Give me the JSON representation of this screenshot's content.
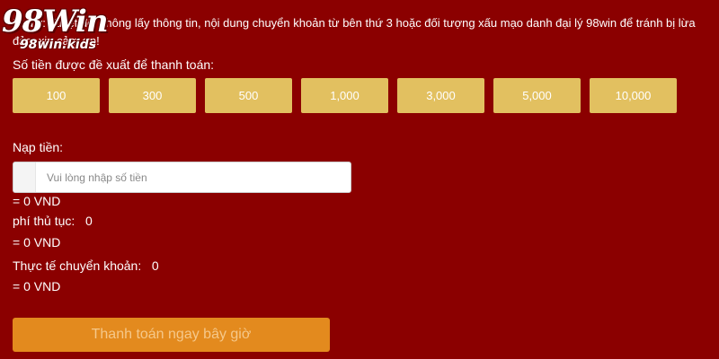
{
  "notice": "Lưu ý: Tuyệt đối không lấy thông tin, nội dung chuyển khoản từ bên thứ 3 hoặc đối tượng xấu mạo danh đại lý 98win để tránh bị lừa đảo, xin cảm ơn!",
  "logo": {
    "main": "98Win",
    "sub": "98win.kids"
  },
  "suggest_label": "Số tiền được đề xuất để thanh toán:",
  "amounts": [
    "100",
    "300",
    "500",
    "1,000",
    "3,000",
    "5,000",
    "10,000"
  ],
  "deposit": {
    "label": "Nạp tiền:",
    "placeholder": "Vui lòng nhập số tiền",
    "value": "",
    "converted": "= 0 VND"
  },
  "fee": {
    "label": "phí thủ tục:",
    "value": "0",
    "converted": "= 0 VND"
  },
  "actual": {
    "label": "Thực tế chuyển khoản:",
    "value": "0",
    "converted": "= 0 VND"
  },
  "pay_button": "Thanh toán ngay bây giờ",
  "colors": {
    "background": "#8b0000",
    "amount_button": "#e2c060",
    "pay_button": "#e38a1e"
  }
}
